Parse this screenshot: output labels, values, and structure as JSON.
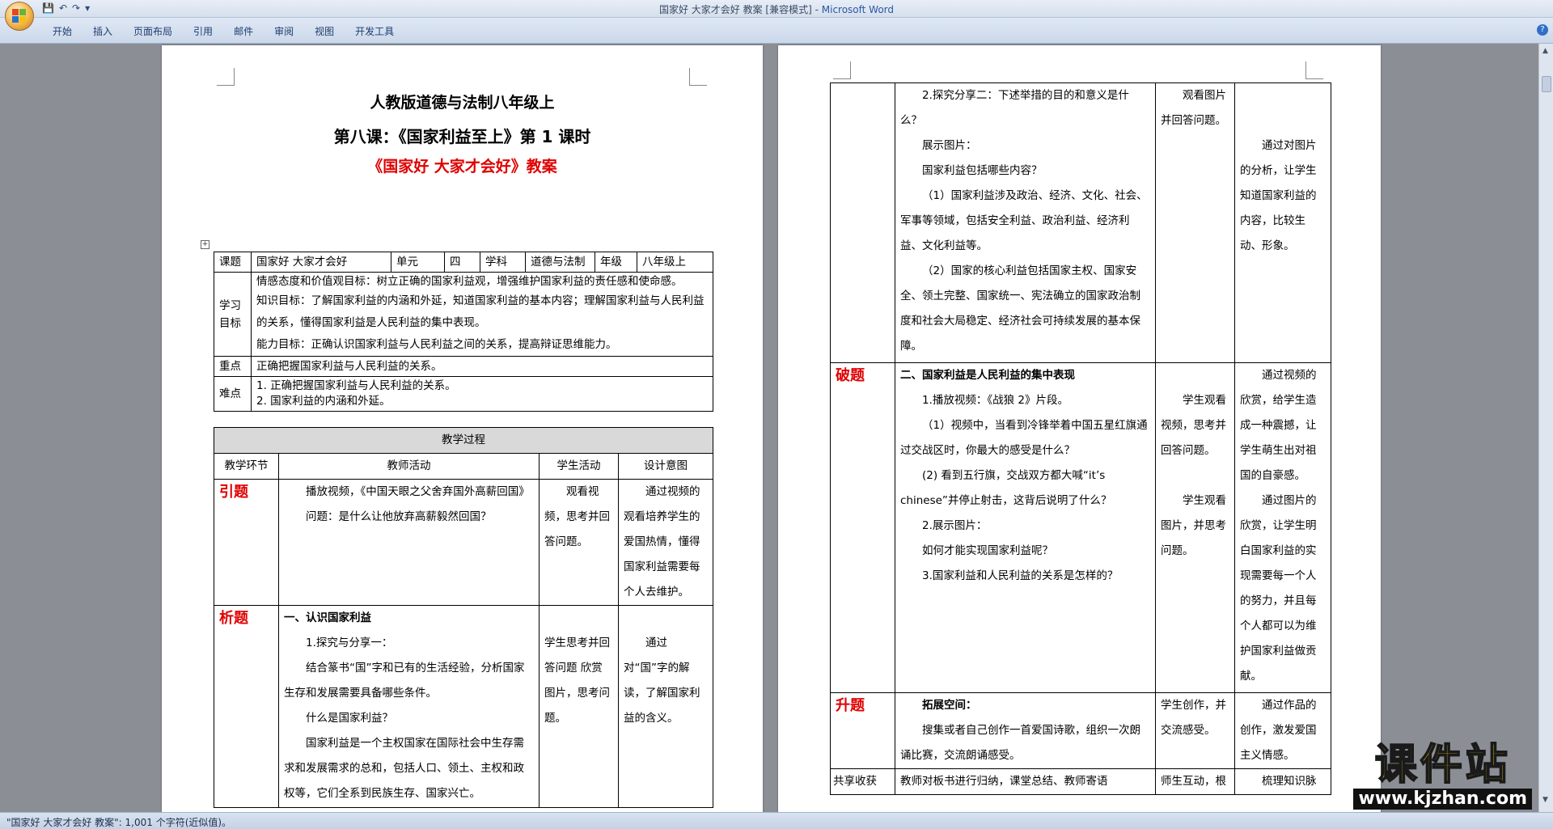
{
  "window": {
    "title": "国家好 大家才会好 教案 [兼容模式] - ",
    "app_name": "Microsoft Word"
  },
  "ribbon": {
    "tabs": [
      "开始",
      "插入",
      "页面布局",
      "引用",
      "邮件",
      "审阅",
      "视图",
      "开发工具"
    ]
  },
  "status": {
    "text": "\"国家好 大家才会好 教案\": 1,001 个字符(近似值)。"
  },
  "document": {
    "heading1": "人教版道德与法制八年级上",
    "heading2": "第八课：《国家利益至上》第 1 课时",
    "heading3": "《国家好  大家才会好》教案",
    "info": {
      "k_topic": "课题",
      "v_topic": "国家好 大家才会好",
      "k_unit": "单元",
      "v_unit": "四",
      "k_subject": "学科",
      "v_subject": "道德与法制",
      "k_grade": "年级",
      "v_grade": "八年级上"
    },
    "goals": {
      "label": "学习目标",
      "lines": [
        "情感态度和价值观目标：树立正确的国家利益观，增强维护国家利益的责任感和使命感。",
        "知识目标：了解国家利益的内涵和外延，知道国家利益的基本内容；理解国家利益与人民利益的关系，懂得国家利益是人民利益的集中表现。",
        "能力目标：正确认识国家利益与人民利益之间的关系，提高辩证思维能力。"
      ]
    },
    "key_point": {
      "label": "重点",
      "text": "正确把握国家利益与人民利益的关系。"
    },
    "difficulty": {
      "label": "难点",
      "lines": [
        "1. 正确把握国家利益与人民利益的关系。",
        "2. 国家利益的内涵和外延。"
      ]
    },
    "process_header": "教学过程",
    "cols": [
      "教学环节",
      "教师活动",
      "学生活动",
      "设计意图"
    ],
    "stage_intro": {
      "name": "引题",
      "teacher": [
        "播放视频，《中国天眼之父舍弃国外高薪回国》",
        "问题：是什么让他放弃高薪毅然回国？"
      ],
      "student": "观看视频，思考并回答问题。",
      "intent": "通过视频的观看培养学生的爱国热情，懂得国家利益需要每个人去维护。"
    },
    "stage_analysis": {
      "name": "析题",
      "teacher_title": "一、认识国家利益",
      "teacher": [
        "1.探究与分享一：",
        "结合篆书“国”字和已有的生活经验，分析国家生存和发展需要具备哪些条件。",
        "什么是国家利益？",
        "国家利益是一个主权国家在国际社会中生存需求和发展需求的总和，包括人口、领土、主权和政权等，它们全系到民族生存、国家兴亡。"
      ],
      "student": "学生思考并回答问题 欣赏图片，思考问题。",
      "intent": "通过对“国”字的解读，了解国家利益的含义。"
    },
    "p2_cont": {
      "teacher": [
        "2.探究分享二：下述举措的目的和意义是什么？",
        "展示图片：",
        "国家利益包括哪些内容？",
        "（1）国家利益涉及政治、经济、文化、社会、军事等领域，包括安全利益、政治利益、经济利益、文化利益等。",
        "（2）国家的核心利益包括国家主权、国家安全、领土完整、国家统一、宪法确立的国家政治制度和社会大局稳定、经济社会可持续发展的基本保障。"
      ],
      "student": "观看图片并回答问题。",
      "intent": "通过对图片的分析，让学生知道国家利益的内容，比较生动、形象。"
    },
    "stage_break": {
      "name": "破题",
      "teacher_title": "二、国家利益是人民利益的集中表现",
      "teacher": [
        "1.播放视频：《战狼 2》片段。",
        "（1）视频中，当看到冷锋举着中国五星红旗通过交战区时，你最大的感受是什么？",
        "(2) 看到五行旗，交战双方都大喊“it’s chinese”并停止射击，这背后说明了什么？",
        "2.展示图片：",
        "如何才能实现国家利益呢？",
        "3.国家利益和人民利益的关系是怎样的？"
      ],
      "student1": "学生观看视频，思考并回答问题。",
      "student2": "学生观看图片，并思考问题。",
      "intent1": "通过视频的欣赏，给学生造成一种震撼，让学生萌生出对祖国的自豪感。",
      "intent2": "通过图片的欣赏，让学生明白国家利益的实现需要每一个人的努力，并且每个人都可以为维护国家利益做贡献。"
    },
    "stage_rise": {
      "name": "升题",
      "teacher_title": "拓展空间：",
      "teacher": "搜集或者自己创作一首爱国诗歌，组织一次朗诵比赛，交流朗诵感受。",
      "student": "学生创作，并交流感受。",
      "intent": "通过作品的创作，激发爱国主义情感。"
    },
    "stage_share": {
      "name": "共享收获",
      "teacher": "教师对板书进行归纳，课堂总结、教师寄语",
      "student": "师生互动，根",
      "intent": "梳理知识脉"
    }
  },
  "watermark": {
    "text": "课件站",
    "url": "www.kjzhan.com"
  },
  "colors": {
    "accent_red": "#e00000",
    "ribbon": "#cbd8ea",
    "workspace": "#8b8f95"
  }
}
